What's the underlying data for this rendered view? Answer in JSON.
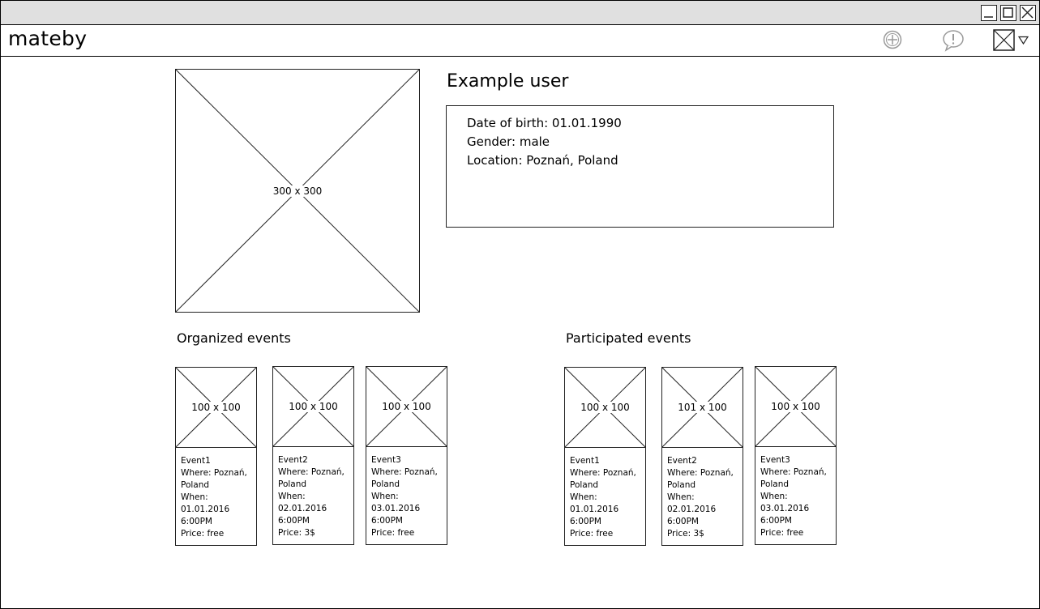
{
  "window": {
    "controls": {
      "minimize_icon": "minimize-icon",
      "maximize_icon": "maximize-icon",
      "close_icon": "close-icon"
    }
  },
  "app": {
    "title": "mateby",
    "icons": [
      "add-circle-icon",
      "alert-bubble-icon",
      "user-avatar-icon",
      "dropdown-triangle-icon"
    ]
  },
  "profile": {
    "photo_label": "300 x 300",
    "name": "Example user",
    "dob": "Date of birth: 01.01.1990",
    "gender": "Gender: male",
    "location": "Location: Poznań, Poland"
  },
  "organized": {
    "title": "Organized events",
    "events": [
      {
        "image_label": "100 x 100",
        "name": "Event1",
        "where_label": "Where: Poznań,",
        "where_cont": "Poland",
        "when_label": "When:",
        "date": "01.01.2016",
        "time": "6:00PM",
        "price": "Price: free"
      },
      {
        "image_label": "100 x 100",
        "name": "Event2",
        "where_label": "Where: Poznań,",
        "where_cont": "Poland",
        "when_label": "When:",
        "date": "02.01.2016",
        "time": "6:00PM",
        "price": "Price: 3$"
      },
      {
        "image_label": "100 x 100",
        "name": "Event3",
        "where_label": "Where: Poznań,",
        "where_cont": "Poland",
        "when_label": "When:",
        "date": "03.01.2016",
        "time": "6:00PM",
        "price": "Price: free"
      }
    ]
  },
  "participated": {
    "title": "Participated events",
    "events": [
      {
        "image_label": "100 x 100",
        "name": "Event1",
        "where_label": "Where: Poznań,",
        "where_cont": "Poland",
        "when_label": "When:",
        "date": "01.01.2016",
        "time": "6:00PM",
        "price": "Price: free"
      },
      {
        "image_label": "101 x 100",
        "name": "Event2",
        "where_label": "Where: Poznań,",
        "where_cont": "Poland",
        "when_label": "When:",
        "date": "02.01.2016",
        "time": "6:00PM",
        "price": "Price: 3$"
      },
      {
        "image_label": "100 x 100",
        "name": "Event3",
        "where_label": "Where: Poznań,",
        "where_cont": "Poland",
        "when_label": "When:",
        "date": "03.01.2016",
        "time": "6:00PM",
        "price": "Price: free"
      }
    ]
  }
}
